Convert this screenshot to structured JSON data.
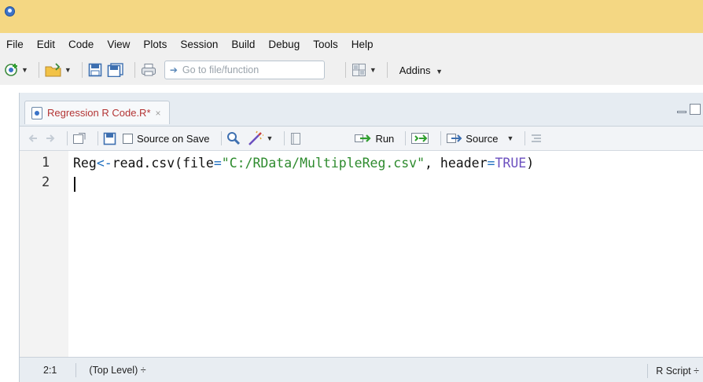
{
  "menu": [
    "File",
    "Edit",
    "Code",
    "View",
    "Plots",
    "Session",
    "Build",
    "Debug",
    "Tools",
    "Help"
  ],
  "toolbar": {
    "goto_placeholder": "Go to file/function",
    "addins_label": "Addins"
  },
  "tab": {
    "label": "Regression R Code.R*",
    "close": "×"
  },
  "editor_toolbar": {
    "source_on_save": "Source on Save",
    "run": "Run",
    "source": "Source"
  },
  "editor": {
    "line_numbers": [
      "1",
      "2"
    ],
    "line1": {
      "var": "Reg",
      "assign": "<-",
      "fn": "read.csv(file",
      "eq1": "=",
      "path": "\"C:/RData/MultipleReg.csv\"",
      "comma": ", header",
      "eq2": "=",
      "value": "TRUE",
      "close": ")"
    }
  },
  "status": {
    "position": "2:1",
    "scope": "(Top Level) ÷",
    "filetype": "R Script ÷"
  },
  "colors": {
    "titlebar": "#f4d783",
    "string": "#2e8b2e",
    "operator": "#1f6fbf",
    "tab_label": "#b33434"
  }
}
